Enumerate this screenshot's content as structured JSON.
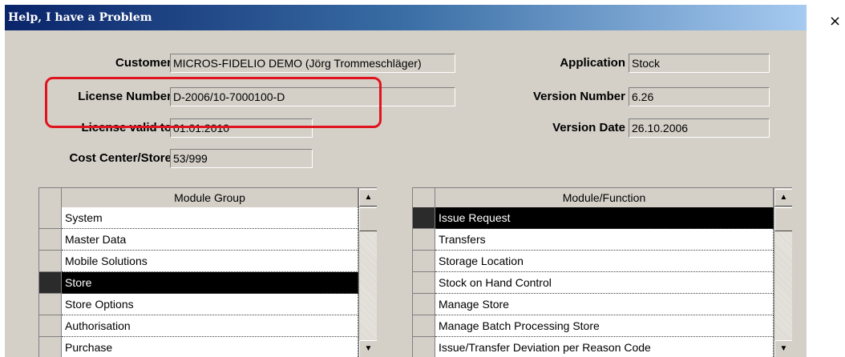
{
  "window": {
    "title": "Help, I have a Problem",
    "close_glyph": "×"
  },
  "fields": {
    "customer": {
      "label": "Customer",
      "value": "MICROS-FIDELIO DEMO (Jörg Trommeschläger)"
    },
    "license_number": {
      "label": "License Number",
      "value": "D-2006/10-7000100-D"
    },
    "license_valid_to": {
      "label": "License valid to",
      "value": "01.01.2010"
    },
    "cost_center": {
      "label": "Cost Center/Store",
      "value": "53/999"
    },
    "application": {
      "label": "Application",
      "value": "Stock"
    },
    "version_number": {
      "label": "Version Number",
      "value": "6.26"
    },
    "version_date": {
      "label": "Version Date",
      "value": "26.10.2006"
    }
  },
  "module_group": {
    "header": "Module Group",
    "rows": [
      "System",
      "Master Data",
      "Mobile Solutions",
      "Store",
      "Store Options",
      "Authorisation",
      "Purchase"
    ],
    "selected_index": 3
  },
  "module_function": {
    "header": "Module/Function",
    "rows": [
      "Issue Request",
      "Transfers",
      "Storage Location",
      "Stock on Hand Control",
      "Manage Store",
      "Manage Batch Processing Store",
      "Issue/Transfer Deviation per Reason Code"
    ],
    "selected_index": 0
  },
  "scroll_icons": {
    "up": "▲",
    "down": "▼"
  },
  "colors": {
    "highlight": "#e0141e",
    "titlebar": "#0a246a",
    "dialog_bg": "#d4d0c8"
  }
}
